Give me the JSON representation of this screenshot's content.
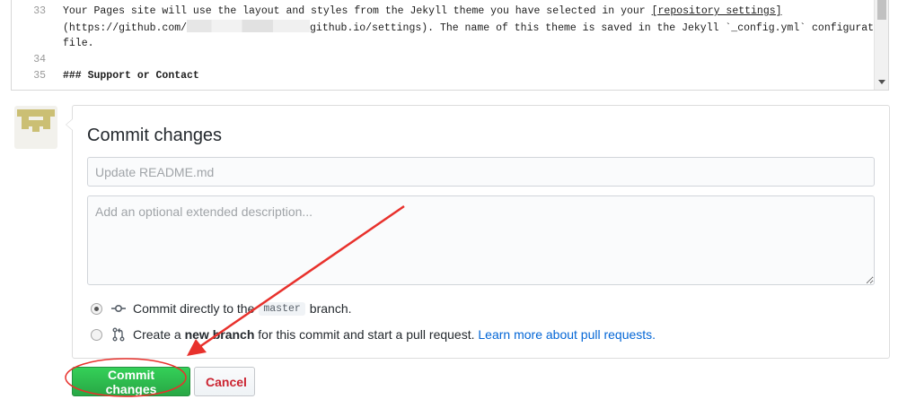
{
  "editor": {
    "lines": [
      {
        "no": "33",
        "pre": "Your Pages site will use the layout and styles from the Jekyll theme you have selected in your ",
        "link": "[repository settings]"
      },
      {
        "no": "",
        "pre": "(https://github.com/",
        "post": "github.io/settings). The name of this theme is saved in the Jekyll `_config.yml` configuration"
      },
      {
        "no": "",
        "text": "file."
      },
      {
        "no": "34",
        "text": ""
      },
      {
        "no": "35",
        "text": "### Support or Contact"
      }
    ]
  },
  "commit": {
    "title": "Commit changes",
    "summary_placeholder": "Update README.md",
    "summary_value": "",
    "description_placeholder": "Add an optional extended description...",
    "description_value": "",
    "option_direct": {
      "prefix": "Commit directly to the",
      "branch": "master",
      "suffix": "branch.",
      "selected": true
    },
    "option_new_branch": {
      "prefix": "Create a",
      "bold": "new branch",
      "suffix": "for this commit and start a pull request.",
      "link": "Learn more about pull requests.",
      "selected": false
    }
  },
  "buttons": {
    "commit": "Commit changes",
    "cancel": "Cancel"
  },
  "colors": {
    "primary": "#28a745",
    "danger": "#cb2431",
    "link": "#0366d6",
    "annotation": "#e8312c"
  },
  "icons": {
    "commit": "git-commit-icon",
    "pull_request": "git-pull-request-icon"
  }
}
